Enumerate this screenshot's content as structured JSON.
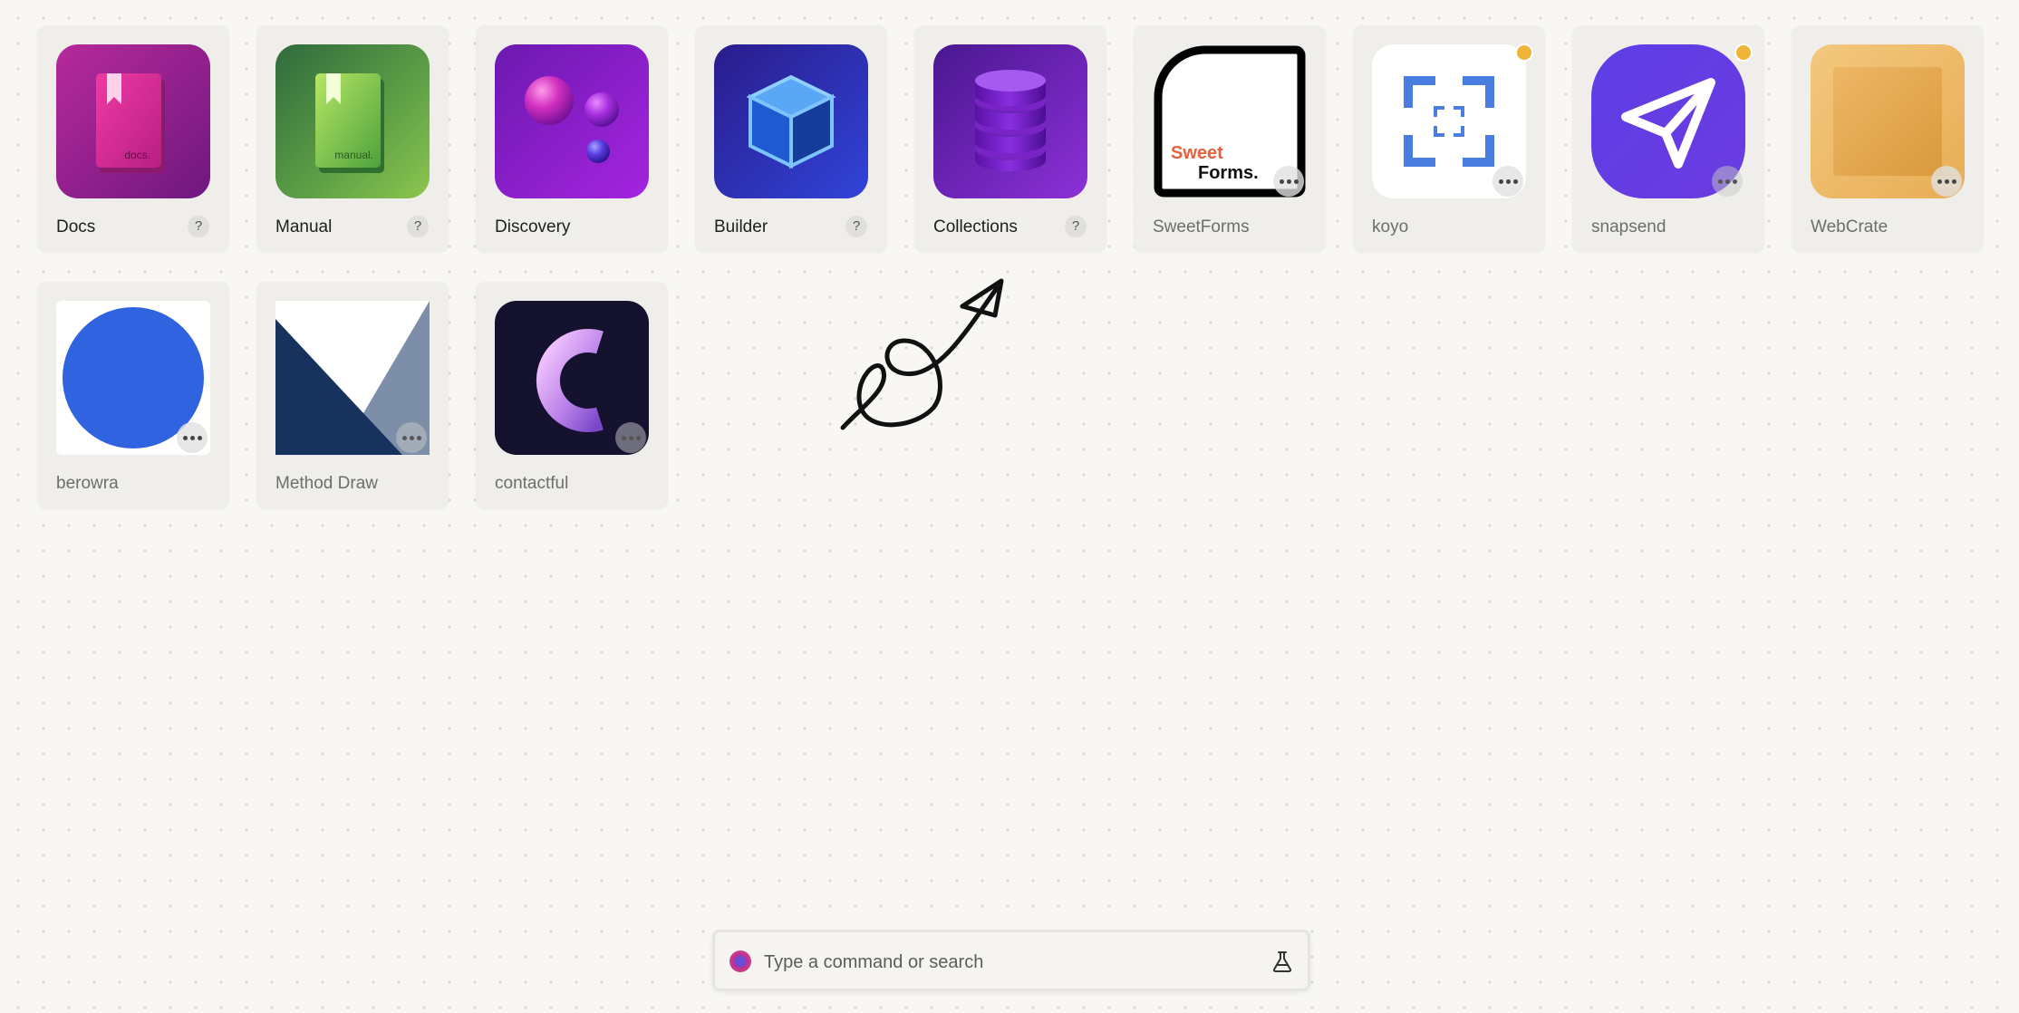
{
  "tiles": [
    {
      "label": "Docs",
      "help": "?"
    },
    {
      "label": "Manual",
      "help": "?"
    },
    {
      "label": "Discovery"
    },
    {
      "label": "Builder",
      "help": "?"
    },
    {
      "label": "Collections",
      "help": "?"
    },
    {
      "label": "SweetForms",
      "icon_text_1": "Sweet",
      "icon_text_2": "Forms."
    },
    {
      "label": "koyo",
      "notification": true
    },
    {
      "label": "snapsend",
      "notification": true
    },
    {
      "label": "WebCrate"
    },
    {
      "label": "berowra"
    },
    {
      "label": "Method Draw"
    },
    {
      "label": "contactful"
    }
  ],
  "icons": {
    "docs_badge": "docs.",
    "manual_badge": "manual."
  },
  "command_bar": {
    "placeholder": "Type a command or search"
  },
  "colors": {
    "notification": "#f0b537",
    "background": "#f8f7f4",
    "tile": "#efeeea"
  }
}
